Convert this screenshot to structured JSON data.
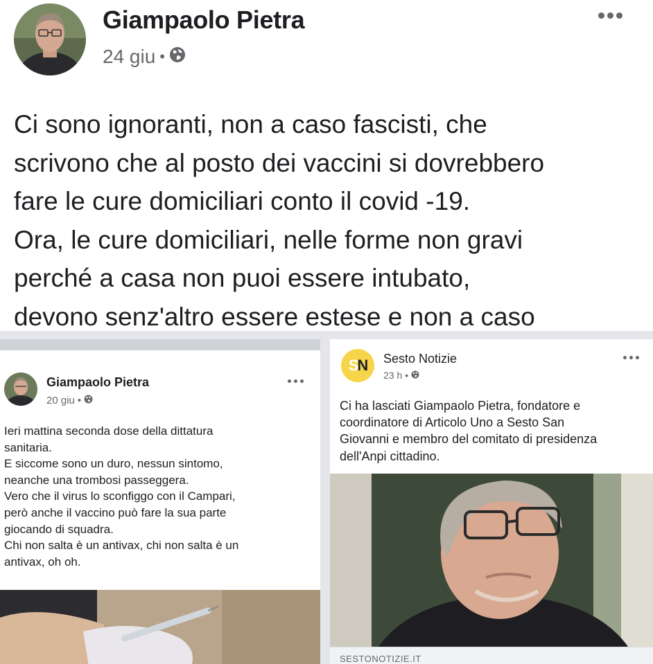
{
  "main_post": {
    "author": "Giampaolo Pietra",
    "date": "24 giu",
    "separator": "•",
    "privacy_icon": "globe-icon",
    "more_icon": "more-options-icon",
    "text_lines": [
      "Ci sono ignoranti, non a caso fascisti, che",
      "scrivono che al posto dei vaccini si dovrebbero",
      "fare le cure domiciliari conto il covid -19.",
      "Ora, le cure domiciliari, nelle forme non gravi",
      "perché a casa non puoi essere intubato,",
      "devono senz'altro essere estese e non a caso"
    ]
  },
  "left_post": {
    "author": "Giampaolo Pietra",
    "date": "20 giu",
    "separator": "•",
    "privacy_icon": "globe-icon",
    "text_lines": [
      "Ieri mattina seconda dose della dittatura",
      "sanitaria.",
      "E siccome sono un duro, nessun sintomo,",
      "neanche una trombosi passeggera.",
      "Vero che il virus lo sconfiggo con il Campari,",
      "però anche il vaccino può fare la sua parte",
      "giocando di squadra.",
      "Chi non salta è un antivax, chi non salta è un",
      "antivax, oh oh."
    ]
  },
  "right_post": {
    "page_name": "Sesto Notizie",
    "logo_letters": {
      "s": "S",
      "n": "N"
    },
    "time": "23 h",
    "separator": "•",
    "privacy_icon": "globe-icon",
    "text_lines": [
      "Ci ha lasciati Giampaolo Pietra, fondatore e",
      "coordinatore di Articolo Uno a Sesto San",
      "Giovanni e membro del comitato di presidenza",
      "dell'Anpi cittadino."
    ],
    "link_source": "SESTONOTIZIE.IT"
  },
  "colors": {
    "text_primary": "#1c1e21",
    "text_secondary": "#65676b",
    "background": "#e4e6ea",
    "logo_yellow": "#f7d54a"
  }
}
